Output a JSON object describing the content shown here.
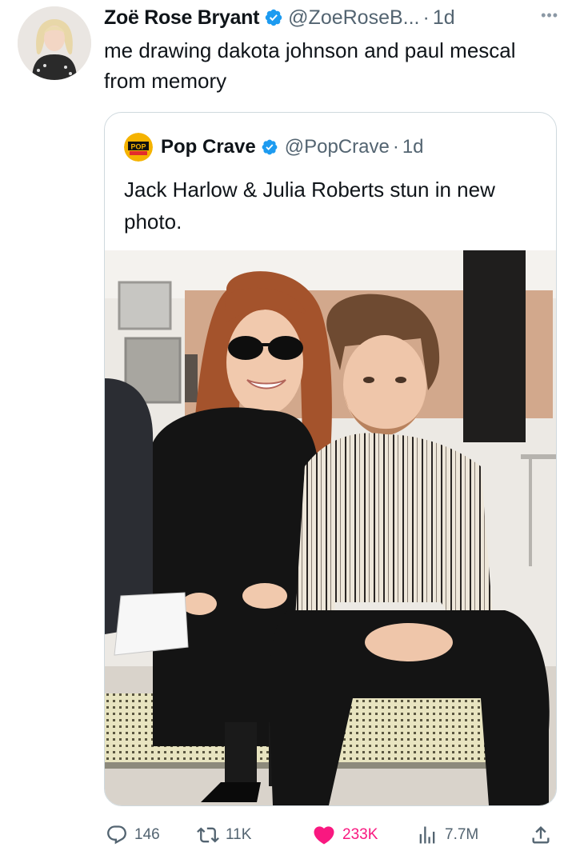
{
  "tweet": {
    "author_name": "Zoë Rose Bryant",
    "handle": "@ZoeRoseB...",
    "separator": "·",
    "time": "1d",
    "text": "me drawing dakota johnson and paul mescal from memory",
    "more_icon": "more-horizontal-icon",
    "verified_icon": "verified-badge-icon",
    "colors": {
      "verified": "#1d9bf0",
      "like": "#f91880",
      "secondary": "#536471",
      "border": "#cfd9de"
    }
  },
  "quote": {
    "author_name": "Pop Crave",
    "handle": "@PopCrave",
    "separator": "·",
    "time": "1d",
    "text": "Jack Harlow & Julia Roberts stun in new photo.",
    "logo_icon": "pop-crave-logo"
  },
  "actions": {
    "reply": {
      "icon": "reply-icon",
      "count": "146"
    },
    "retweet": {
      "icon": "retweet-icon",
      "count": "11K"
    },
    "like": {
      "icon": "heart-filled-icon",
      "count": "233K",
      "liked": true
    },
    "views": {
      "icon": "analytics-icon",
      "count": "7.7M"
    },
    "share": {
      "icon": "share-icon"
    }
  }
}
